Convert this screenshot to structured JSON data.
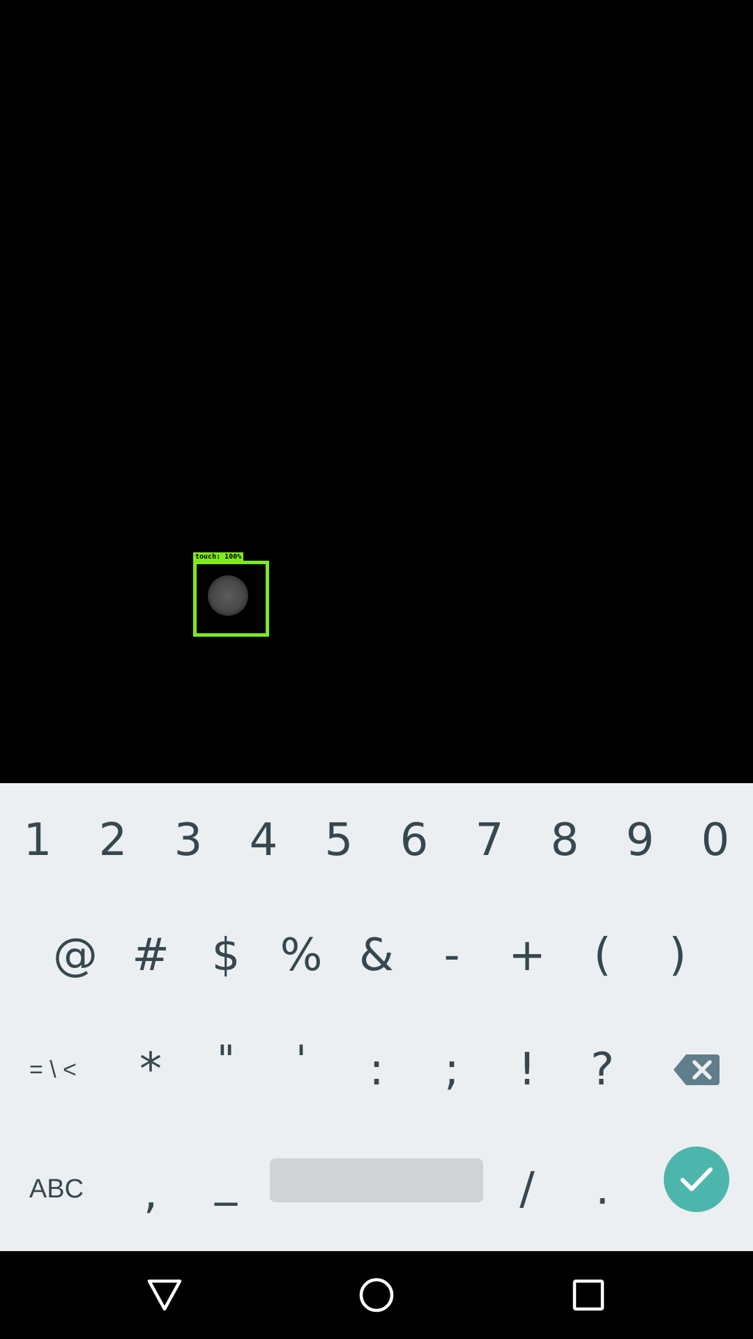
{
  "overlay": {
    "detection_label": "touch: 100%",
    "detection_color": "#7dea1a"
  },
  "keyboard": {
    "row1": [
      "1",
      "2",
      "3",
      "4",
      "5",
      "6",
      "7",
      "8",
      "9",
      "0"
    ],
    "row2": [
      "@",
      "#",
      "$",
      "%",
      "&",
      "-",
      "+",
      "(",
      ")"
    ],
    "row3": {
      "more_symbols_label": "= \\ <",
      "keys": [
        "*",
        "\"",
        "'",
        ":",
        ";",
        "!",
        "?"
      ],
      "delete_icon": "backspace-icon"
    },
    "row4": {
      "abc_label": "ABC",
      "comma": ",",
      "underscore": "_",
      "slash": "/",
      "period": ".",
      "enter_icon": "check-icon",
      "enter_color": "#4db6ac"
    },
    "background": "#eceff1",
    "key_text_color": "#37474f"
  },
  "navigation": {
    "back_icon": "back-triangle-icon",
    "home_icon": "home-circle-icon",
    "recents_icon": "recents-square-icon"
  }
}
